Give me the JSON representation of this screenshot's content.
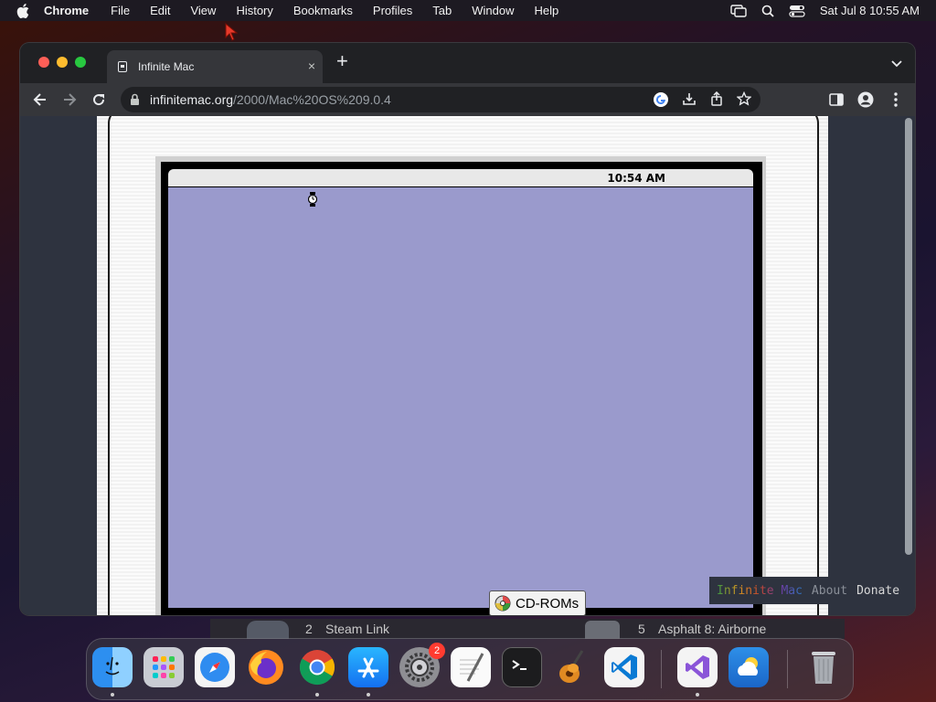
{
  "menubar": {
    "app": "Chrome",
    "items": [
      "File",
      "Edit",
      "View",
      "History",
      "Bookmarks",
      "Profiles",
      "Tab",
      "Window",
      "Help"
    ],
    "datetime": "Sat Jul 8  10:55 AM"
  },
  "browser": {
    "tab_title": "Infinite Mac",
    "tab_close": "×",
    "new_tab": "+",
    "url_host": "infinitemac.org",
    "url_path": "/2000/Mac%20OS%209.0.4"
  },
  "emulator": {
    "clock": "10:54 AM",
    "cdrom_button": "CD-ROMs",
    "desktop_color": "#9a9acc",
    "links": {
      "logo": "Infinite Mac",
      "about": "About",
      "donate": "Donate"
    }
  },
  "behind": {
    "item1_index": "2",
    "item1_label": "Steam Link",
    "item2_index": "5",
    "item2_label": "Asphalt 8: Airborne"
  },
  "dock": {
    "apps": [
      "Finder",
      "Launchpad",
      "Safari",
      "Firefox",
      "Chrome",
      "App Store",
      "System Settings",
      "TextEdit",
      "Terminal",
      "GarageBand",
      "Visual Studio Code",
      "Visual Studio",
      "Weather",
      "Trash"
    ],
    "settings_badge": "2"
  }
}
